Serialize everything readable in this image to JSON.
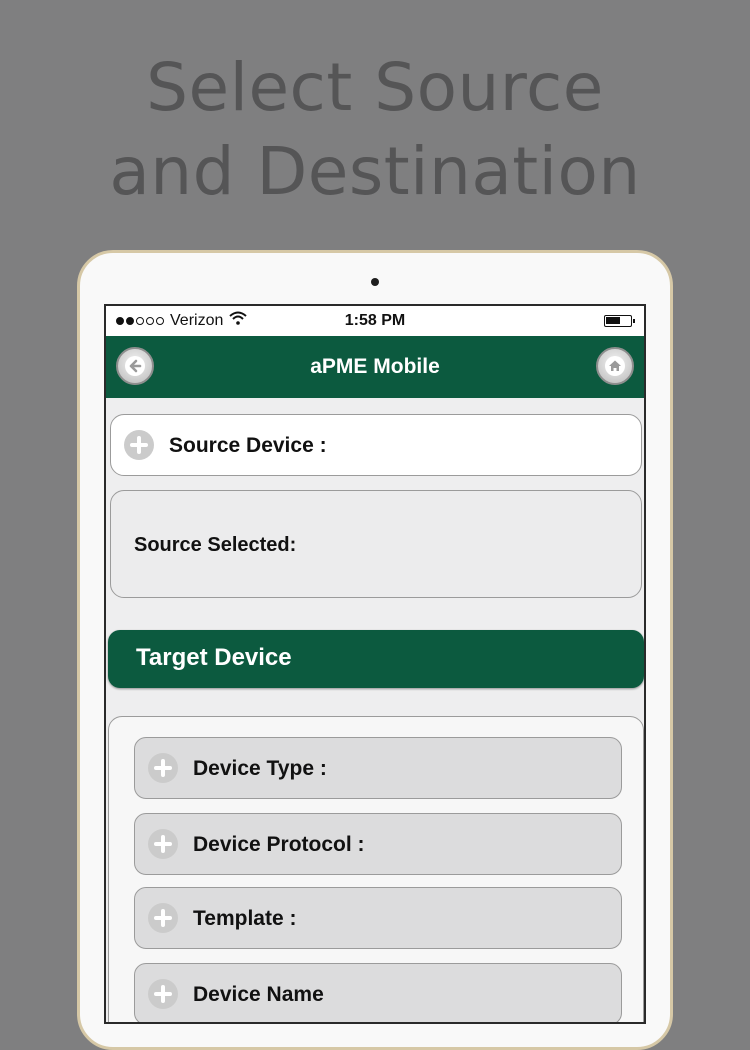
{
  "headline": {
    "line1": "Select Source",
    "line2": "and Destination"
  },
  "statusbar": {
    "carrier": "Verizon",
    "time": "1:58 PM",
    "signal_bars": 2,
    "battery_level": 0.5
  },
  "navbar": {
    "title": "aPME Mobile",
    "back_icon": "back-arrow-icon",
    "home_icon": "home-icon"
  },
  "source": {
    "device_label": "Source Device :",
    "selected_label": "Source Selected:"
  },
  "target": {
    "header": "Target Device",
    "fields": [
      "Device Type :",
      "Device Protocol :",
      "Template :",
      "Device Name"
    ]
  },
  "colors": {
    "brand_green": "#0c5a3f",
    "background": "#7f7f80",
    "field_bg": "#dcdcdd"
  }
}
